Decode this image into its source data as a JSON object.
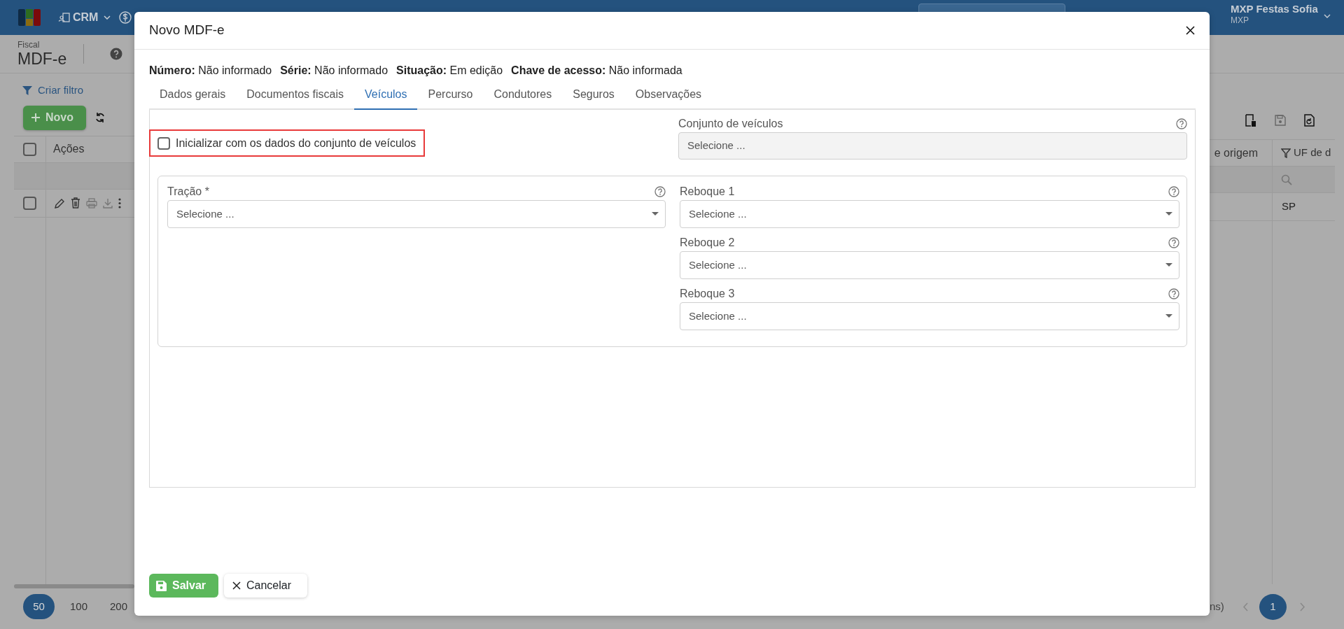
{
  "navbar": {
    "menus": [
      {
        "label": "CRM"
      }
    ],
    "user": {
      "name": "MXP Festas Sofia",
      "company": "MXP"
    }
  },
  "page": {
    "section": "Fiscal",
    "title": "MDF-e"
  },
  "filter_link": "Criar filtro",
  "new_button": "Novo",
  "table": {
    "columns": [
      {
        "label": "Ações"
      },
      {
        "label": "e origem"
      },
      {
        "label": "UF de d"
      }
    ],
    "header_checkbox": {
      "checked": false
    },
    "rows": [
      {
        "checked": false,
        "column_3": "SP"
      }
    ]
  },
  "pagination": {
    "page_sizes": [
      {
        "label": "50",
        "selected": true
      },
      {
        "label": "100",
        "selected": false
      },
      {
        "label": "200",
        "selected": false
      }
    ],
    "count_text": "ns)",
    "pages": [
      {
        "label": "1",
        "selected": true
      }
    ]
  },
  "dialog": {
    "title": "Novo MDF-e",
    "info": [
      {
        "label": "Número:",
        "value": "Não informado"
      },
      {
        "label": "Série:",
        "value": "Não informado"
      },
      {
        "label": "Situação:",
        "value": "Em edição"
      },
      {
        "label": "Chave de acesso:",
        "value": "Não informada"
      }
    ],
    "tabs": [
      {
        "label": "Dados gerais",
        "selected": false
      },
      {
        "label": "Documentos fiscais",
        "selected": false
      },
      {
        "label": "Veículos",
        "selected": true
      },
      {
        "label": "Percurso",
        "selected": false
      },
      {
        "label": "Condutores",
        "selected": false
      },
      {
        "label": "Seguros",
        "selected": false
      },
      {
        "label": "Observações",
        "selected": false
      }
    ],
    "init_checkbox": {
      "label": "Inicializar com os dados do conjunto de veículos",
      "checked": false,
      "highlighted": true
    },
    "vehicle_set": {
      "label": "Conjunto de veículos",
      "placeholder": "Selecione ...",
      "disabled": true
    },
    "traction": {
      "label": "Tração *",
      "placeholder": "Selecione ..."
    },
    "trailers": [
      {
        "label": "Reboque 1",
        "placeholder": "Selecione ..."
      },
      {
        "label": "Reboque 2",
        "placeholder": "Selecione ..."
      },
      {
        "label": "Reboque 3",
        "placeholder": "Selecione ..."
      }
    ],
    "buttons": [
      {
        "kind": "save",
        "label": "Salvar"
      },
      {
        "kind": "cancel",
        "label": "Cancelar"
      }
    ]
  }
}
